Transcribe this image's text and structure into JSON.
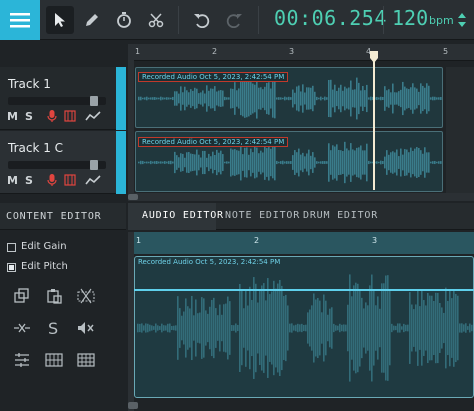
{
  "toolbar": {
    "time": "00:06.254",
    "tempo": "120",
    "tempo_unit": "bpm"
  },
  "ruler": {
    "marks": [
      "1",
      "2",
      "3",
      "4",
      "5"
    ]
  },
  "tracks": [
    {
      "name": "Track 1",
      "mute": "M",
      "solo": "S",
      "region_label": "Recorded Audio Oct 5, 2023, 2:42:54 PM"
    },
    {
      "name": "Track 1 C",
      "mute": "M",
      "solo": "S",
      "region_label": "Recorded Audio Oct 5, 2023, 2:42:54 PM"
    }
  ],
  "content_editor": {
    "title": "CONTENT EDITOR",
    "edit_gain": "Edit Gain",
    "edit_pitch": "Edit Pitch"
  },
  "tabs": [
    "AUDIO EDITOR",
    "NOTE EDITOR",
    "DRUM EDITOR"
  ],
  "editor": {
    "ruler_marks": [
      "1",
      "2",
      "3"
    ],
    "region_label": "Recorded Audio Oct 5, 2023, 2:42:54 PM"
  },
  "colors": {
    "accent": "#2bb5d8",
    "time": "#4ecfb3",
    "wave": "#3a7c8b"
  }
}
